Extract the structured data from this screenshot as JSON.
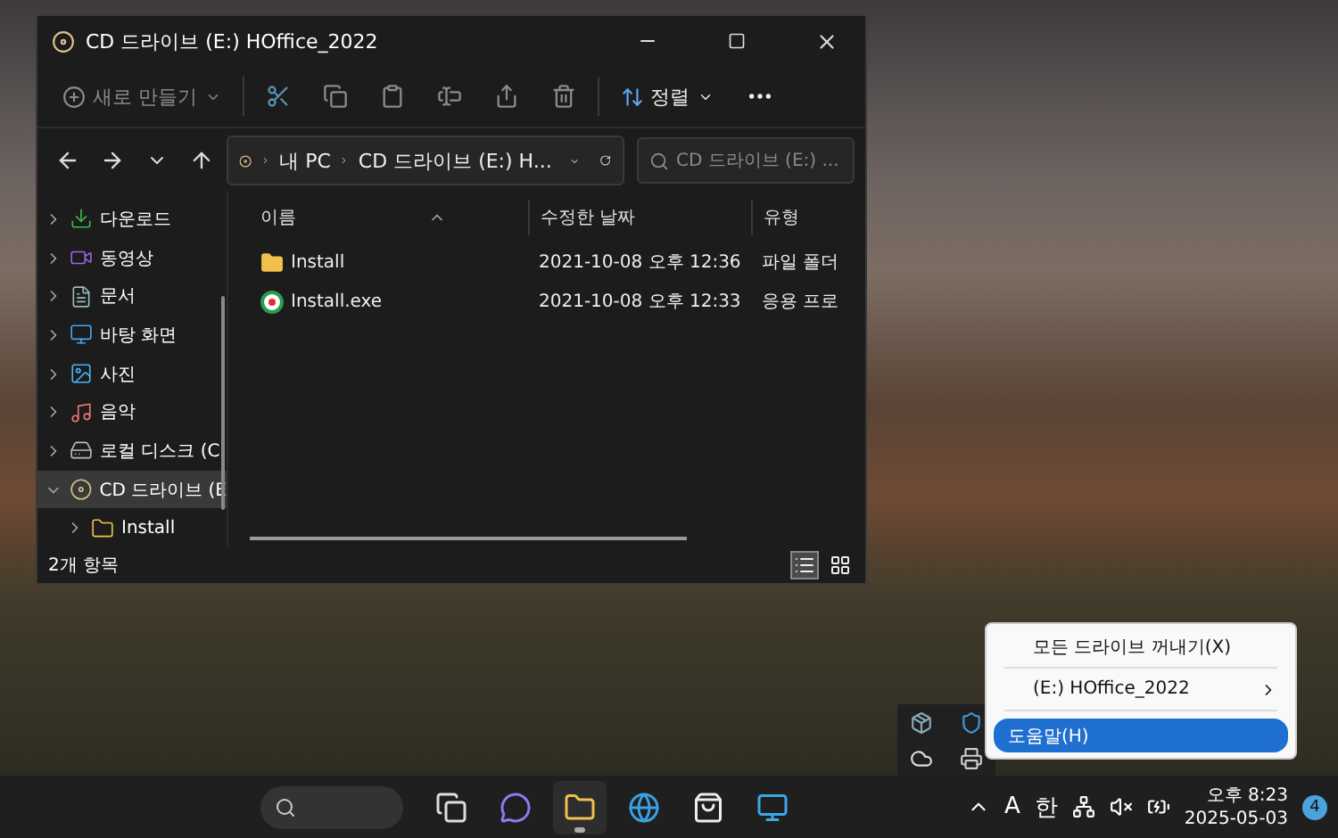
{
  "window": {
    "title": "CD 드라이브 (E:) HOffice_2022"
  },
  "command_bar": {
    "new_button": "새로 만들기",
    "sort_button": "정렬"
  },
  "address_bar": {
    "segments": [
      "내 PC",
      "CD 드라이브 (E:) H..."
    ],
    "search_placeholder": "CD 드라이브 (E:) ..."
  },
  "sidebar": {
    "items": [
      {
        "label": "다운로드",
        "kind": "download",
        "selected": false,
        "expanded": false
      },
      {
        "label": "동영상",
        "kind": "video",
        "selected": false,
        "expanded": false
      },
      {
        "label": "문서",
        "kind": "document",
        "selected": false,
        "expanded": false
      },
      {
        "label": "바탕 화면",
        "kind": "desktop",
        "selected": false,
        "expanded": false
      },
      {
        "label": "사진",
        "kind": "picture",
        "selected": false,
        "expanded": false
      },
      {
        "label": "음악",
        "kind": "music",
        "selected": false,
        "expanded": false
      },
      {
        "label": "로컬 디스크 (C",
        "kind": "drive",
        "selected": false,
        "expanded": false
      },
      {
        "label": "CD 드라이브 (E",
        "kind": "disc",
        "selected": true,
        "expanded": true,
        "children": [
          {
            "label": "Install",
            "kind": "folder",
            "selected": false,
            "expanded": false
          }
        ]
      }
    ]
  },
  "file_list": {
    "columns": [
      "이름",
      "수정한 날짜",
      "유형"
    ],
    "rows": [
      {
        "name": "Install",
        "kind": "folder",
        "modified": "2021-10-08 오후 12:36",
        "type": "파일 폴더"
      },
      {
        "name": "Install.exe",
        "kind": "app",
        "modified": "2021-10-08 오후 12:33",
        "type": "응용 프로"
      }
    ]
  },
  "status_bar": {
    "item_count": "2개 항목",
    "view_modes": [
      {
        "kind": "details",
        "selected": true
      },
      {
        "kind": "tiles",
        "selected": false
      }
    ]
  },
  "context_menu": {
    "items": [
      {
        "label": "모든 드라이브 꺼내기(X)",
        "kind": "item",
        "selected": false
      },
      {
        "kind": "separator"
      },
      {
        "label": "(E:) HOffice_2022",
        "kind": "submenu",
        "selected": false
      },
      {
        "kind": "separator"
      },
      {
        "label": "도움말(H)",
        "kind": "item",
        "selected": true
      }
    ]
  },
  "taskbar": {
    "apps": [
      {
        "kind": "taskview",
        "active": false
      },
      {
        "kind": "chat",
        "active": false
      },
      {
        "kind": "explorer",
        "active": true
      },
      {
        "kind": "edge",
        "active": false
      },
      {
        "kind": "store",
        "active": false
      },
      {
        "kind": "app",
        "active": false
      }
    ]
  },
  "tray": {
    "input_mode": "A",
    "ime": "한",
    "time": "오후 8:23",
    "date": "2025-05-03",
    "notifications": "4"
  }
}
